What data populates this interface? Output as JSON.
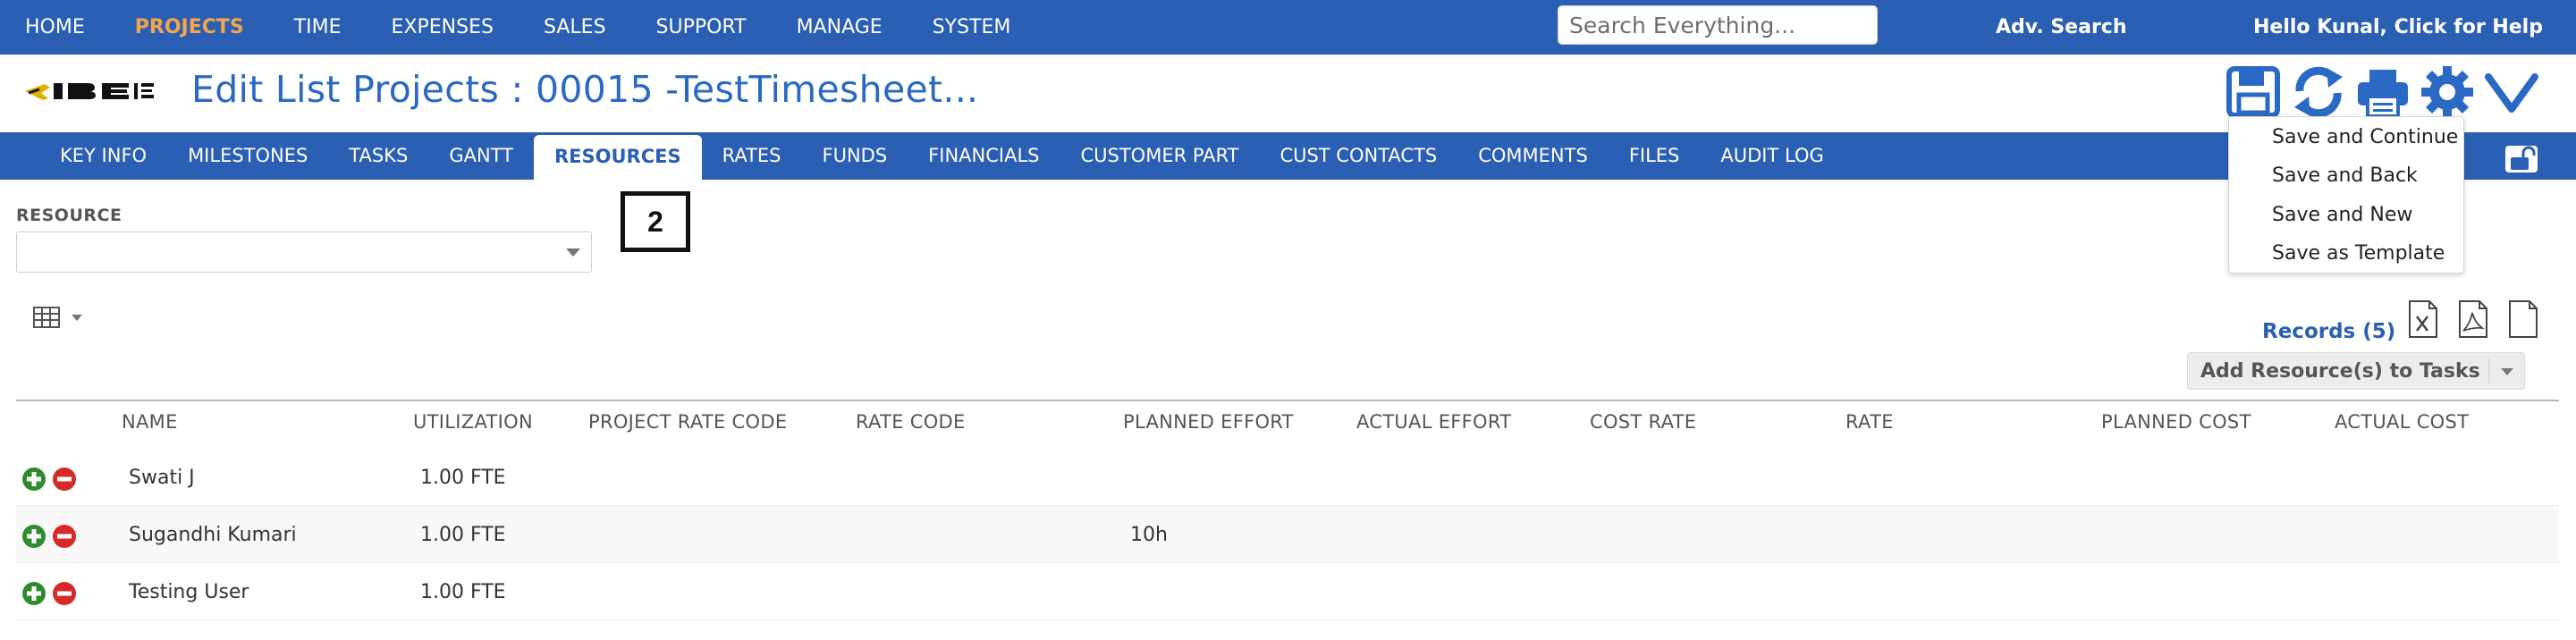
{
  "top_nav": {
    "items": [
      "HOME",
      "PROJECTS",
      "TIME",
      "EXPENSES",
      "SALES",
      "SUPPORT",
      "MANAGE",
      "SYSTEM"
    ],
    "active": "PROJECTS",
    "search_placeholder": "Search Everything...",
    "adv_search": "Adv. Search",
    "greeting": "Hello Kunal, Click for Help"
  },
  "header": {
    "logo_alt": "IBE",
    "title": "Edit List Projects : 00015 -TestTimesheet..."
  },
  "toolbar": {
    "icons": [
      "save-icon",
      "refresh-icon",
      "print-icon",
      "settings-gear-icon",
      "chevron-down-icon"
    ]
  },
  "save_menu": {
    "options": [
      "Save and Continue",
      "Save and Back",
      "Save and New",
      "Save as Template"
    ]
  },
  "tabs": {
    "items": [
      "KEY INFO",
      "MILESTONES",
      "TASKS",
      "GANTT",
      "RESOURCES",
      "RATES",
      "FUNDS",
      "FINANCIALS",
      "CUSTOMER PART",
      "CUST CONTACTS",
      "COMMENTS",
      "FILES",
      "AUDIT LOG"
    ],
    "active": "RESOURCES"
  },
  "filter": {
    "resource_label": "RESOURCE",
    "resource_value": ""
  },
  "annotation_badge": "2",
  "records": {
    "label": "Records (5)",
    "export_icons": [
      "excel-export-icon",
      "pdf-export-icon",
      "document-export-icon"
    ]
  },
  "add_button": {
    "label": "Add Resource(s) to Tasks"
  },
  "table": {
    "columns": [
      "NAME",
      "UTILIZATION",
      "PROJECT RATE CODE",
      "RATE CODE",
      "PLANNED EFFORT",
      "ACTUAL EFFORT",
      "COST RATE",
      "RATE",
      "PLANNED COST",
      "ACTUAL COST"
    ],
    "rows": [
      {
        "name": "Swati J",
        "utilization": "1.00 FTE",
        "project_rate_code": "",
        "rate_code": "",
        "planned_effort": "",
        "actual_effort": "",
        "cost_rate": "",
        "rate": "",
        "planned_cost": "",
        "actual_cost": ""
      },
      {
        "name": "Sugandhi Kumari",
        "utilization": "1.00 FTE",
        "project_rate_code": "",
        "rate_code": "",
        "planned_effort": "10h",
        "actual_effort": "",
        "cost_rate": "",
        "rate": "",
        "planned_cost": "",
        "actual_cost": ""
      },
      {
        "name": "Testing User",
        "utilization": "1.00 FTE",
        "project_rate_code": "",
        "rate_code": "",
        "planned_effort": "",
        "actual_effort": "",
        "cost_rate": "",
        "rate": "",
        "planned_cost": "",
        "actual_cost": ""
      }
    ]
  },
  "colors": {
    "nav_blue": "#2a5fb3",
    "active_nav": "#f4a54a",
    "title_blue": "#2a6ac4",
    "add_green": "#2e8b2e",
    "remove_red": "#d42a2a"
  }
}
